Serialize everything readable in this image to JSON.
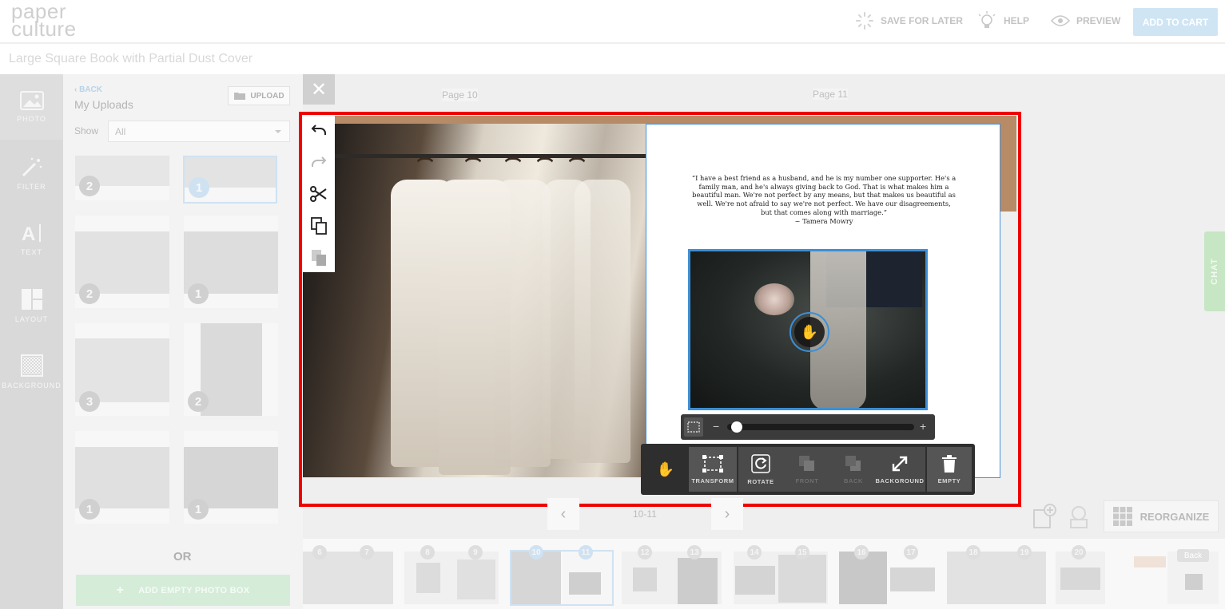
{
  "header": {
    "logo_line1": "paper",
    "logo_line2": "culture",
    "save_label": "SAVE FOR LATER",
    "help_label": "HELP",
    "preview_label": "PREVIEW",
    "cart_label": "ADD TO CART"
  },
  "book_title": "Large Square Book with Partial Dust Cover",
  "rail": [
    {
      "label": "PHOTO",
      "icon": "photo-icon"
    },
    {
      "label": "FILTER",
      "icon": "magic-wand-icon"
    },
    {
      "label": "TEXT",
      "icon": "text-icon"
    },
    {
      "label": "LAYOUT",
      "icon": "layout-icon"
    },
    {
      "label": "BACKGROUND",
      "icon": "background-icon"
    }
  ],
  "panel": {
    "back_label": "BACK",
    "title": "My Uploads",
    "upload_label": "UPLOAD",
    "show_label": "Show",
    "show_value": "All",
    "thumb_counts": [
      "2",
      "1",
      "2",
      "1",
      "3",
      "2",
      "1",
      "1"
    ],
    "or_label": "OR",
    "empty_box_label": "ADD EMPTY PHOTO BOX"
  },
  "canvas": {
    "left_page_label": "Page 10",
    "right_page_label": "Page 11",
    "quote_lines": [
      "“I have a best friend as a husband, and he is my number one supporter. He's a",
      "family man, and he's always giving back to God. That is what makes him a",
      "beautiful man. We're not perfect by any means, but that makes us beautiful as",
      "well. We're not afraid to say we're not perfect. We have our disagreements,",
      "but that comes along with marriage.”",
      "~ Tamera Mowry"
    ],
    "zoom_level": 0.05
  },
  "actions": {
    "transform": "TRANSFORM",
    "rotate": "ROTATE",
    "front": "FRONT",
    "back": "BACK",
    "background": "BACKGROUND",
    "empty": "EMPTY"
  },
  "pagination": {
    "current": "10-11"
  },
  "reorganize_label": "REORGANIZE",
  "chat_label": "CHAT",
  "filmstrip": {
    "pages": [
      "6",
      "7",
      "8",
      "9",
      "10",
      "11",
      "12",
      "13",
      "14",
      "15",
      "16",
      "17",
      "18",
      "19",
      "20"
    ],
    "back_label": "Back"
  },
  "colors": {
    "accent_blue": "#3c8fd6",
    "highlight_red": "#ee0000",
    "cart_bg": "#cfe5f4",
    "chat_bg": "#c7e6c4"
  }
}
